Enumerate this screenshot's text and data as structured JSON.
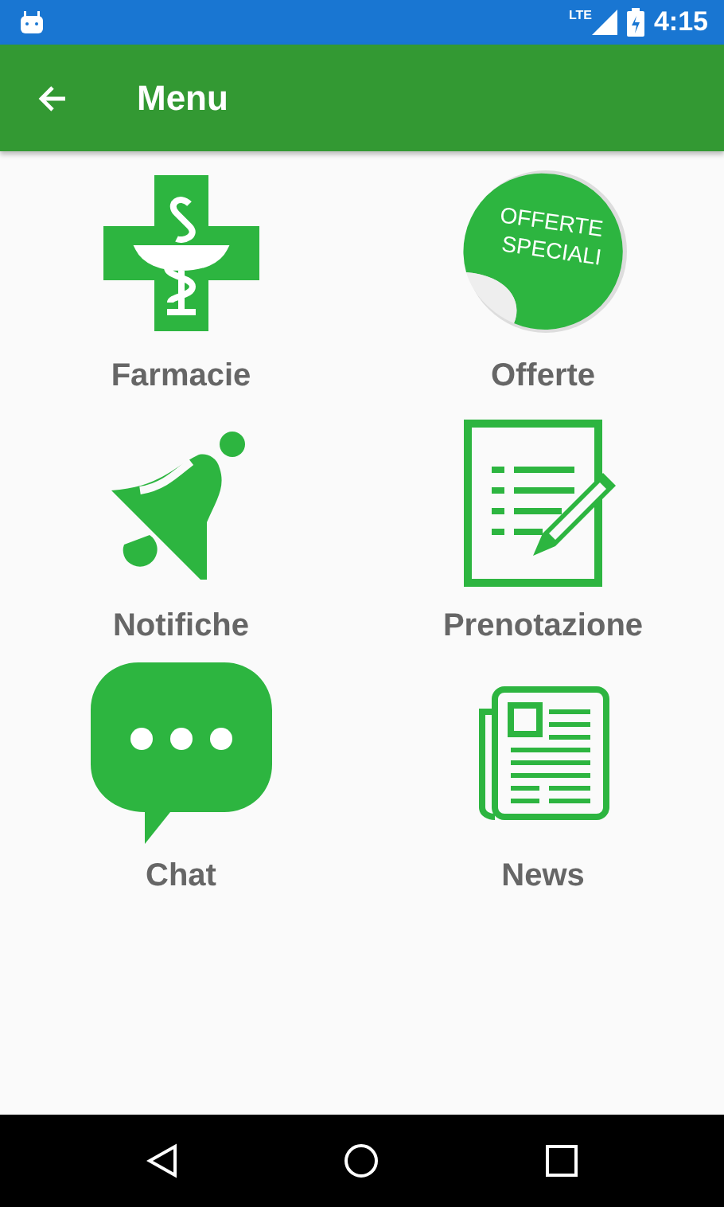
{
  "status_bar": {
    "network": "LTE",
    "time": "4:15"
  },
  "app_bar": {
    "title": "Menu"
  },
  "menu_items": [
    {
      "kind": "pharmacy",
      "label": "Farmacie"
    },
    {
      "kind": "sticker",
      "label": "Offerte",
      "sticker_text": [
        "OFFERTE",
        "SPECIALI"
      ]
    },
    {
      "kind": "bell",
      "label": "Notifiche"
    },
    {
      "kind": "form",
      "label": "Prenotazione"
    },
    {
      "kind": "chat",
      "label": "Chat"
    },
    {
      "kind": "news",
      "label": "News"
    }
  ]
}
